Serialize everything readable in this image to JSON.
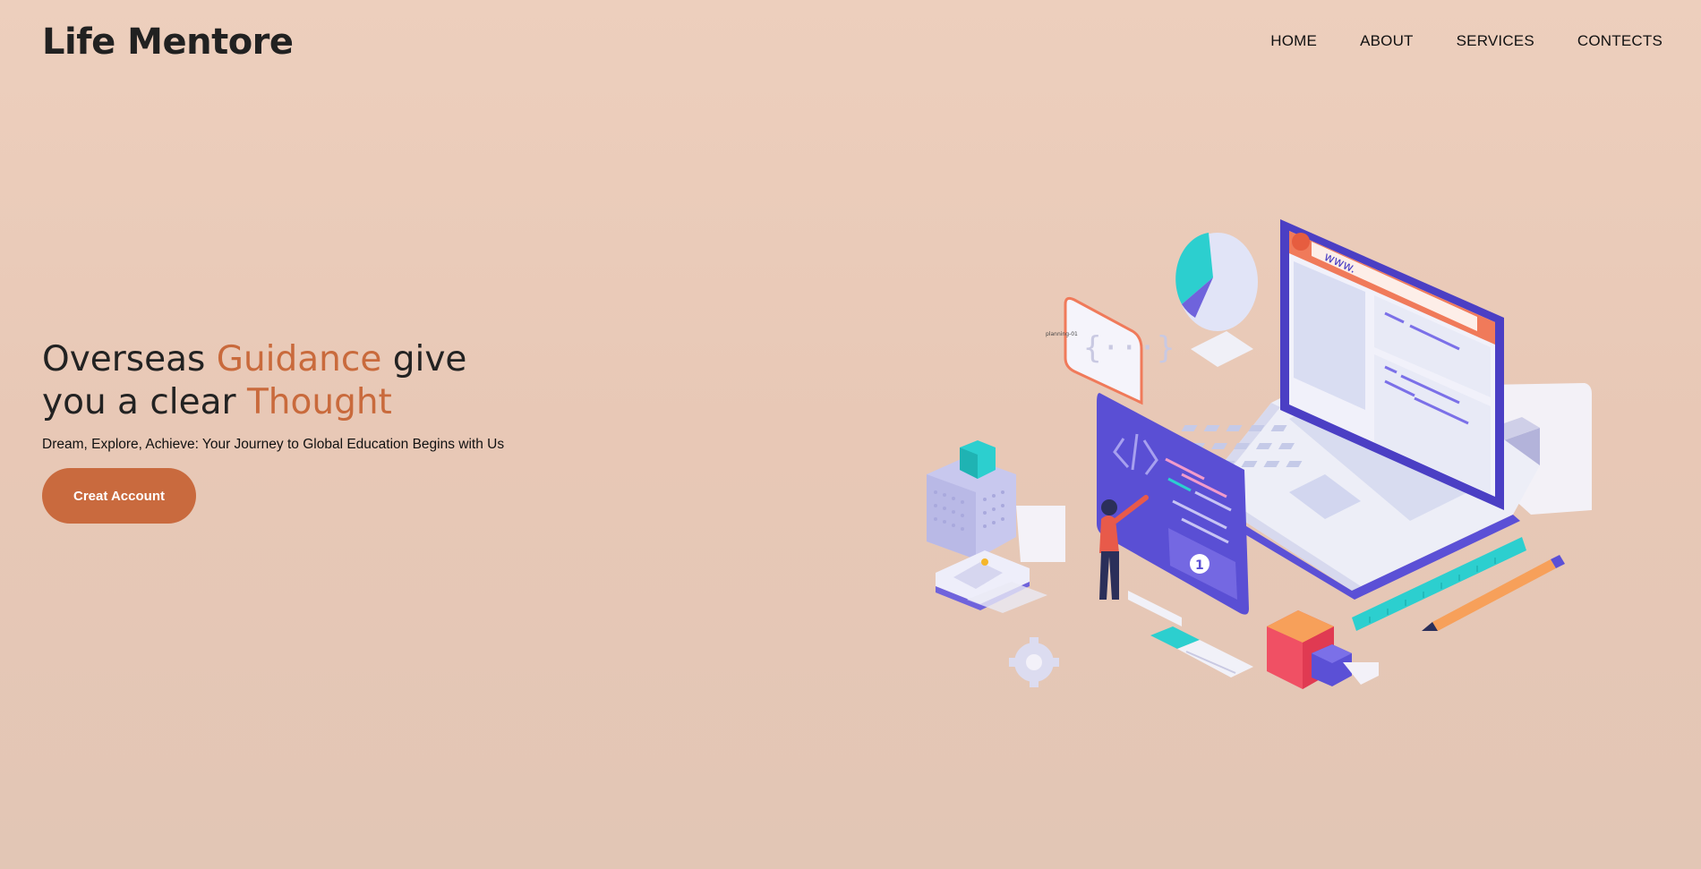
{
  "brand": {
    "name": "Life Mentore"
  },
  "nav": {
    "items": [
      {
        "label": "HOME"
      },
      {
        "label": "ABOUT"
      },
      {
        "label": "SERVICES"
      },
      {
        "label": "CONTECTS"
      }
    ]
  },
  "hero": {
    "title_part1": "Overseas ",
    "title_accent1": "Guidance",
    "title_part2": " give you a clear ",
    "title_accent2": "Thought",
    "subtitle": "Dream, Explore, Achieve: Your Journey to Global Education Begins with Us",
    "cta_label": "Creat Account"
  },
  "illustration": {
    "browser_url": "www.",
    "card_label": "planning-01",
    "step_number": "1",
    "icons": [
      "laptop-icon",
      "pie-chart-icon",
      "code-card-icon",
      "person-icon",
      "cube-icon",
      "ruler-icon",
      "pencil-icon",
      "gear-icon",
      "image-card-icon"
    ]
  },
  "colors": {
    "accent": "#c96a3c",
    "indigo": "#5b50d6",
    "teal": "#2ccfcf",
    "background": "#ecccba"
  }
}
